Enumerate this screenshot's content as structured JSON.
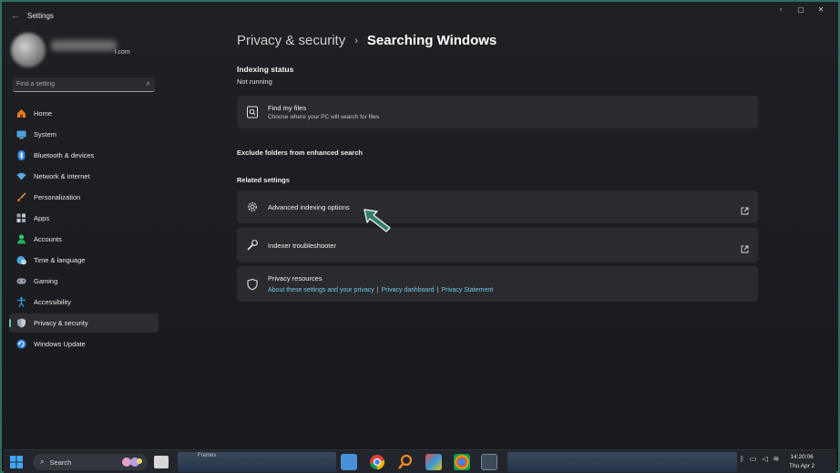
{
  "window": {
    "title": "Settings",
    "controls": {
      "minimize": "▫",
      "maximize": "▢",
      "close": "✕"
    }
  },
  "account": {
    "email_suffix": "l.com"
  },
  "search": {
    "placeholder": "Find a setting",
    "icon": "search-icon"
  },
  "sidebar": {
    "items": [
      {
        "label": "Home",
        "icon": "home-icon",
        "color": "#e67e22"
      },
      {
        "label": "System",
        "icon": "monitor-icon",
        "color": "#4aa3df"
      },
      {
        "label": "Bluetooth & devices",
        "icon": "bluetooth-icon",
        "color": "#2e86de"
      },
      {
        "label": "Network & internet",
        "icon": "wifi-icon",
        "color": "#5aa9e6"
      },
      {
        "label": "Personalization",
        "icon": "brush-icon",
        "color": "#e67e22"
      },
      {
        "label": "Apps",
        "icon": "apps-icon",
        "color": "#9aa7b4"
      },
      {
        "label": "Accounts",
        "icon": "person-icon",
        "color": "#2ecc71"
      },
      {
        "label": "Time & language",
        "icon": "globe-clock-icon",
        "color": "#4aa3df"
      },
      {
        "label": "Gaming",
        "icon": "gamepad-icon",
        "color": "#9aa7b4"
      },
      {
        "label": "Accessibility",
        "icon": "accessibility-icon",
        "color": "#3498db"
      },
      {
        "label": "Privacy & security",
        "icon": "shield-icon",
        "color": "#9aa7b4",
        "active": true
      },
      {
        "label": "Windows Update",
        "icon": "update-icon",
        "color": "#2e86de"
      }
    ]
  },
  "breadcrumb": {
    "parent": "Privacy & security",
    "separator": "›",
    "current": "Searching Windows"
  },
  "indexing": {
    "title": "Indexing status",
    "status": "Not running"
  },
  "find_my_files": {
    "title": "Find my files",
    "subtitle": "Choose where your PC will search for files",
    "icon": "search-file-icon"
  },
  "exclude_folders": {
    "title": "Exclude folders from enhanced search"
  },
  "related": {
    "heading": "Related settings",
    "advanced": {
      "title": "Advanced indexing options",
      "icon": "gear-icon"
    },
    "troubleshooter": {
      "title": "Indexer troubleshooter",
      "icon": "wrench-icon"
    },
    "privacy": {
      "title": "Privacy resources",
      "icon": "shield-outline-icon",
      "links": [
        "About these settings and your privacy",
        "Privacy dashboard",
        "Privacy Statement"
      ],
      "link_separator": "|"
    }
  },
  "taskbar": {
    "search_label": "Search",
    "preview_label": "Frames",
    "clock": {
      "time": "14:20:06",
      "date": "Thu Apr 2"
    }
  },
  "colors": {
    "accent": "#5dc9b4",
    "link": "#74c6e8",
    "card": "#2a2b2f",
    "pointer": "#2f7d6d"
  }
}
